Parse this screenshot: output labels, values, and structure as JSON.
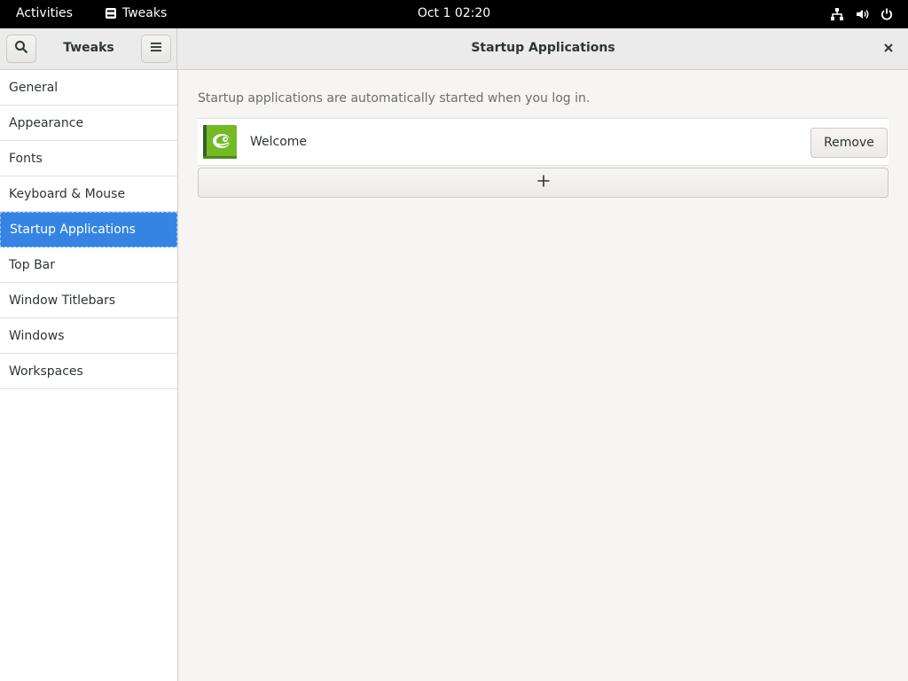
{
  "topbar": {
    "activities": "Activities",
    "app_name": "Tweaks",
    "clock": "Oct 1  02:20",
    "status_icons": [
      "network-icon",
      "volume-icon",
      "power-icon"
    ]
  },
  "header": {
    "sidebar_title": "Tweaks",
    "page_title": "Startup Applications"
  },
  "sidebar": {
    "items": [
      {
        "label": "General"
      },
      {
        "label": "Appearance"
      },
      {
        "label": "Fonts"
      },
      {
        "label": "Keyboard & Mouse"
      },
      {
        "label": "Startup Applications",
        "selected": true
      },
      {
        "label": "Top Bar"
      },
      {
        "label": "Window Titlebars"
      },
      {
        "label": "Windows"
      },
      {
        "label": "Workspaces"
      }
    ]
  },
  "main": {
    "description": "Startup applications are automatically started when you log in.",
    "apps": [
      {
        "name": "Welcome",
        "icon": "opensuse-welcome-icon",
        "remove_label": "Remove"
      }
    ],
    "add_icon": "plus-icon"
  },
  "colors": {
    "accent": "#3584e4",
    "topbar_bg": "#000000",
    "icon_green": "#73ba25"
  }
}
